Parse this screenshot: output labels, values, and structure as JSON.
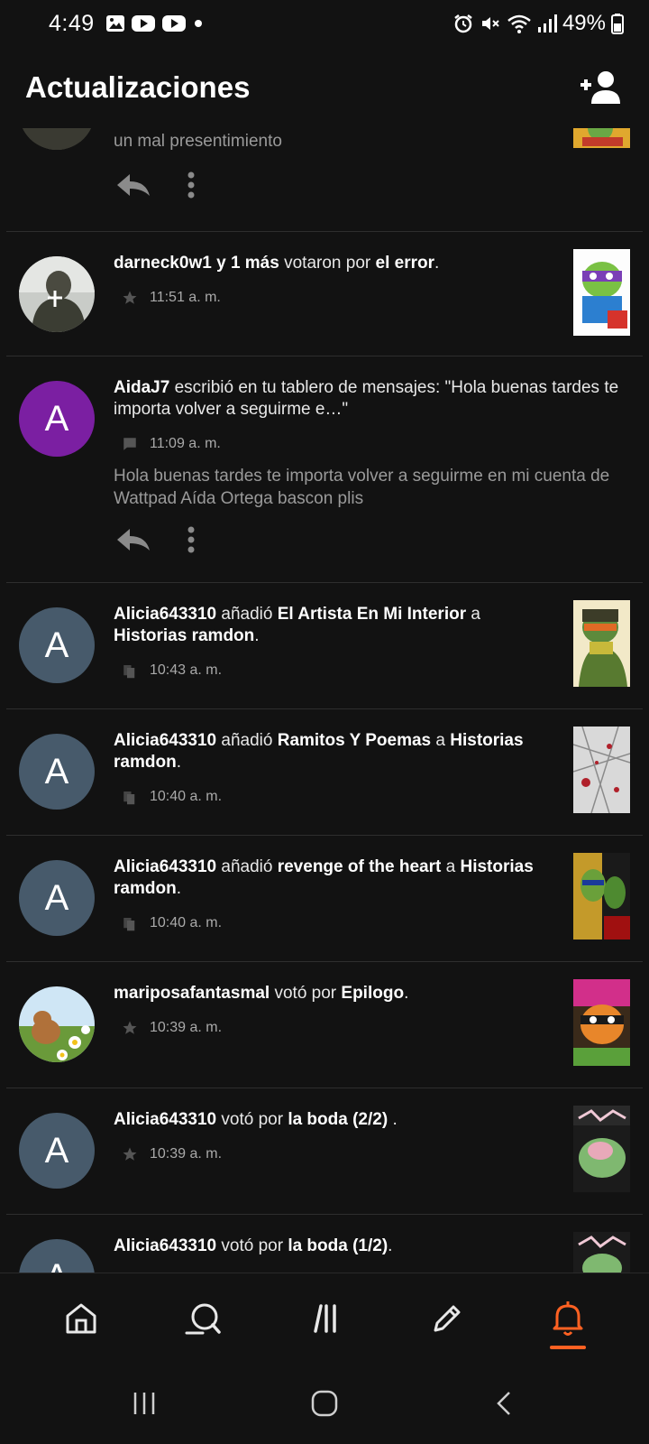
{
  "status_bar": {
    "time": "4:49",
    "battery": "49%"
  },
  "header": {
    "title": "Actualizaciones"
  },
  "feed": [
    {
      "type": "partial",
      "preview": "un mal presentimiento"
    },
    {
      "type": "vote",
      "user": "darneck0w1",
      "connector": "y",
      "others": "1 más",
      "action": "votaron por",
      "target": "el error",
      "suffix": ".",
      "time": "11:51 a. m.",
      "meta_icon": "star-icon"
    },
    {
      "type": "message",
      "avatar_letter": "A",
      "user": "AidaJ7",
      "action": "escribió en tu tablero de mensajes: \"Hola buenas tardes te importa volver a seguirme e…\"",
      "time": "11:09 a. m.",
      "meta_icon": "chat-icon",
      "preview": "Hola buenas tardes te importa volver a seguirme en mi cuenta de Wattpad Aída Ortega bascon plis"
    },
    {
      "type": "library",
      "avatar_letter": "A",
      "user": "Alicia643310",
      "action": "añadió",
      "story": "El Artista En Mi Interior",
      "connector": "a",
      "list": "Historias ramdon",
      "suffix": ".",
      "time": "10:43 a. m.",
      "meta_icon": "library-icon"
    },
    {
      "type": "library",
      "avatar_letter": "A",
      "user": "Alicia643310",
      "action": "añadió",
      "story": "Ramitos Y Poemas",
      "connector": "a",
      "list": "Historias ramdon",
      "suffix": ".",
      "time": "10:40 a. m.",
      "meta_icon": "library-icon"
    },
    {
      "type": "library",
      "avatar_letter": "A",
      "user": "Alicia643310",
      "action": "añadió",
      "story": "revenge of the heart",
      "connector": "a",
      "list": "Historias ramdon",
      "suffix": ".",
      "time": "10:40 a. m.",
      "meta_icon": "library-icon"
    },
    {
      "type": "vote",
      "user": "mariposafantasmal",
      "action": "votó por",
      "target": "Epilogo",
      "suffix": ".",
      "time": "10:39 a. m.",
      "meta_icon": "star-icon"
    },
    {
      "type": "vote",
      "avatar_letter": "A",
      "user": "Alicia643310",
      "action": "votó por",
      "target": "la boda (2/2)",
      "suffix": " .",
      "time": "10:39 a. m.",
      "meta_icon": "star-icon"
    },
    {
      "type": "vote",
      "avatar_letter": "A",
      "user": "Alicia643310",
      "action": "votó por",
      "target": "la boda (1/2)",
      "suffix": "."
    }
  ],
  "bottom_nav": [
    {
      "name": "home-icon",
      "active": false
    },
    {
      "name": "search-icon",
      "active": false
    },
    {
      "name": "library-icon",
      "active": false
    },
    {
      "name": "write-icon",
      "active": false
    },
    {
      "name": "notifications-icon",
      "active": true
    }
  ],
  "colors": {
    "accent": "#ff6122",
    "background": "#121212",
    "avatar_purple": "#7b1fa2",
    "avatar_slate": "#475a6b"
  }
}
